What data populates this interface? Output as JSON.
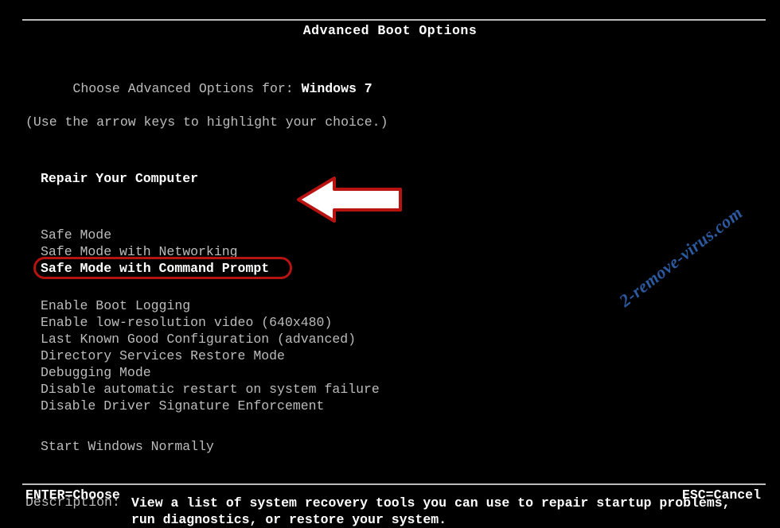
{
  "title": "Advanced Boot Options",
  "chooseLabel": "Choose Advanced Options for: ",
  "osName": "Windows 7",
  "hint": "(Use the arrow keys to highlight your choice.)",
  "options": {
    "repair": "Repair Your Computer",
    "safe": "Safe Mode",
    "safeNet": "Safe Mode with Networking",
    "safeCmd": "Safe Mode with Command Prompt",
    "bootlog": "Enable Boot Logging",
    "lowres": "Enable low-resolution video (640x480)",
    "lkgc": "Last Known Good Configuration (advanced)",
    "dsrm": "Directory Services Restore Mode",
    "debug": "Debugging Mode",
    "noautorestart": "Disable automatic restart on system failure",
    "nodrvsig": "Disable Driver Signature Enforcement",
    "normal": "Start Windows Normally"
  },
  "descLabel": "Description:",
  "descText": "View a list of system recovery tools you can use to repair startup problems, run diagnostics, or restore your system.",
  "footer": {
    "enter": "ENTER=Choose",
    "esc": "ESC=Cancel"
  },
  "watermark": "2-remove-virus.com",
  "annotation": {
    "highlightColor": "#b71310",
    "arrowFill": "#ffffff",
    "arrowStroke": "#b71310"
  }
}
